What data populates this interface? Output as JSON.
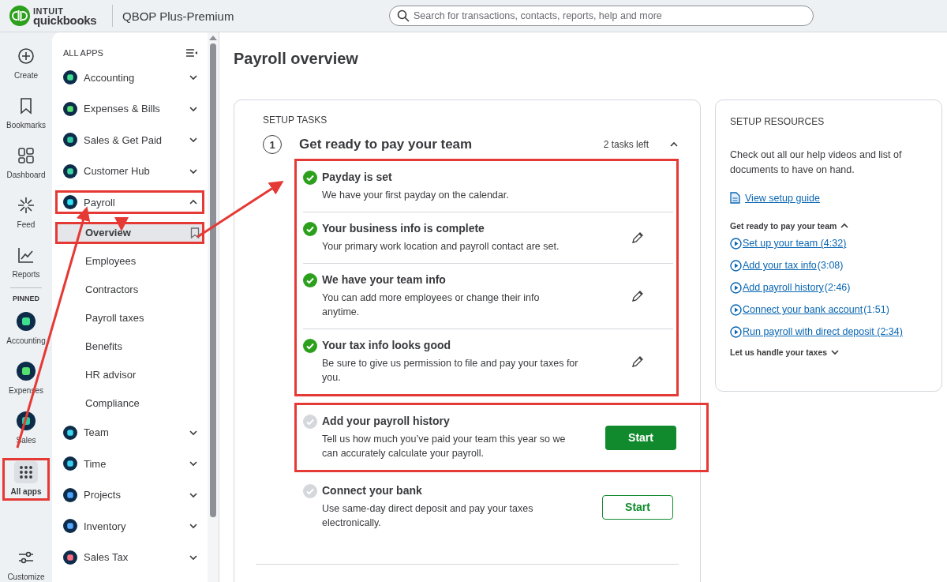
{
  "brand": {
    "logo_top": "INTUIT",
    "logo_bottom": "quickbooks",
    "product": "QBOP Plus-Premium"
  },
  "search": {
    "placeholder": "Search for transactions, contacts, reports, help and more"
  },
  "rail": {
    "items": [
      {
        "label": "Create",
        "selected": false,
        "highlighted": false
      },
      {
        "label": "Bookmarks",
        "selected": false,
        "highlighted": false
      },
      {
        "label": "Dashboard",
        "selected": false,
        "highlighted": false
      },
      {
        "label": "Feed",
        "selected": false,
        "highlighted": false
      },
      {
        "label": "Reports",
        "selected": false,
        "highlighted": false
      }
    ],
    "pinned_label": "PINNED",
    "pinned": [
      {
        "label": "Accounting",
        "kind": "app",
        "color": "#3ee08f",
        "selected": false,
        "highlighted": false
      },
      {
        "label": "Expenses",
        "kind": "app",
        "color": "#53e06e",
        "selected": false,
        "highlighted": false
      },
      {
        "label": "Sales",
        "kind": "app",
        "color": "#2fc9a0",
        "selected": false,
        "highlighted": false
      },
      {
        "label": "All apps",
        "kind": "all_apps",
        "selected": true,
        "highlighted": true
      }
    ],
    "bottom": {
      "label": "Customize"
    }
  },
  "sidebar": {
    "title": "ALL APPS",
    "apps": [
      {
        "label": "Accounting",
        "color": "#3ee08f",
        "expanded": false,
        "highlighted": false
      },
      {
        "label": "Expenses & Bills",
        "color": "#53e06e",
        "expanded": false,
        "highlighted": false
      },
      {
        "label": "Sales & Get Paid",
        "color": "#2fc9a0",
        "expanded": false,
        "highlighted": false
      },
      {
        "label": "Customer Hub",
        "color": "#3dd6a3",
        "expanded": false,
        "highlighted": false
      },
      {
        "label": "Payroll",
        "color": "#2ee4f5",
        "expanded": true,
        "highlighted": true,
        "children": [
          {
            "label": "Overview",
            "selected": true,
            "highlighted": true
          },
          {
            "label": "Employees",
            "selected": false,
            "highlighted": false
          },
          {
            "label": "Contractors",
            "selected": false,
            "highlighted": false
          },
          {
            "label": "Payroll taxes",
            "selected": false,
            "highlighted": false
          },
          {
            "label": "Benefits",
            "selected": false,
            "highlighted": false
          },
          {
            "label": "HR advisor",
            "selected": false,
            "highlighted": false
          },
          {
            "label": "Compliance",
            "selected": false,
            "highlighted": false
          }
        ]
      },
      {
        "label": "Team",
        "color": "#38d6ef",
        "expanded": false,
        "highlighted": false
      },
      {
        "label": "Time",
        "color": "#38d0f2",
        "expanded": false,
        "highlighted": false
      },
      {
        "label": "Projects",
        "color": "#4aa3ff",
        "expanded": false,
        "highlighted": false
      },
      {
        "label": "Inventory",
        "color": "#55a7ff",
        "expanded": false,
        "highlighted": false
      },
      {
        "label": "Sales Tax",
        "color": "#ff6b81",
        "expanded": false,
        "highlighted": false
      }
    ]
  },
  "page": {
    "title": "Payroll overview"
  },
  "setup_tasks": {
    "title": "SETUP TASKS",
    "step": "1",
    "heading": "Get ready to pay your team",
    "remaining": "2 tasks left",
    "expanded": true,
    "groups": [
      {
        "highlighted": true,
        "tasks": [
          {
            "title": "Payday is set",
            "description": "We have your first payday on the calendar.",
            "done": true
          },
          {
            "title": "Your business info is complete",
            "description": "Your primary work location and payroll contact are set.",
            "done": true,
            "action": {
              "kind": "edit"
            }
          },
          {
            "title": "We have your team info",
            "description": "You can add more employees or change their info anytime.",
            "done": true,
            "action": {
              "kind": "edit"
            }
          },
          {
            "title": "Your tax info looks good",
            "description": "Be sure to give us permission to file and pay your taxes for you.",
            "done": true,
            "action": {
              "kind": "edit"
            }
          }
        ]
      },
      {
        "highlighted": true,
        "tasks": [
          {
            "title": "Add your payroll history",
            "description": "Tell us how much you’ve paid your team this year so we can accurately calculate your payroll.",
            "done": false,
            "action": {
              "kind": "start",
              "label": "Start",
              "primary": true
            }
          }
        ]
      },
      {
        "highlighted": false,
        "tasks": [
          {
            "title": "Connect your bank",
            "description": "Use same-day direct deposit and pay your taxes electronically.",
            "done": false,
            "action": {
              "kind": "start",
              "label": "Start",
              "primary": false
            }
          }
        ]
      }
    ]
  },
  "resources": {
    "title": "SETUP RESOURCES",
    "intro": "Check out all our help videos and list of documents to have on hand.",
    "guide_link": "View setup guide",
    "sections": [
      {
        "label": "Get ready to pay your team",
        "expanded": true,
        "videos": [
          {
            "link": "Set up your team (4:32)"
          },
          {
            "link": "Add your tax info",
            "duration": "(3:08)"
          },
          {
            "link": "Add payroll history",
            "duration": "(2:46)"
          },
          {
            "link": "Connect your bank account",
            "duration": "(1:51)"
          },
          {
            "link": "Run payroll with direct deposit (2:34)"
          }
        ]
      },
      {
        "label": "Let us handle your taxes",
        "expanded": false
      }
    ]
  }
}
